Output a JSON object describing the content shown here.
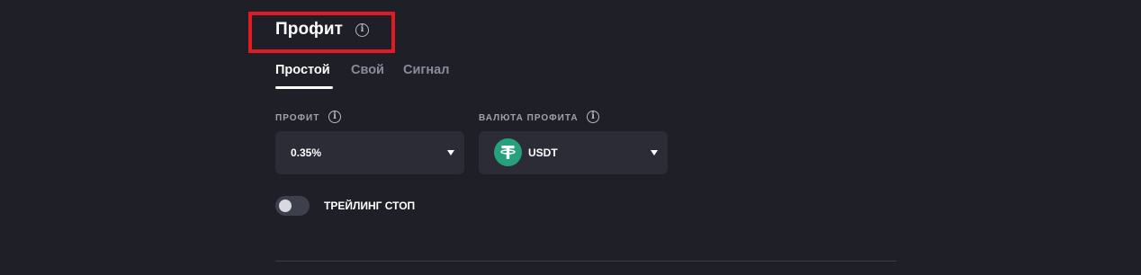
{
  "section": {
    "title": "Профит",
    "info_icon": "info-icon"
  },
  "tabs": [
    {
      "label": "Простой",
      "active": true
    },
    {
      "label": "Свой",
      "active": false
    },
    {
      "label": "Сигнал",
      "active": false
    }
  ],
  "profit_field": {
    "label": "ПРОФИТ",
    "value": "0.35%",
    "info_icon": "info-icon",
    "caret_icon": "caret-down-icon"
  },
  "currency_field": {
    "label": "ВАЛЮТА ПРОФИТА",
    "value": "USDT",
    "coin_icon": "tether-icon",
    "info_icon": "info-icon",
    "caret_icon": "caret-down-icon"
  },
  "trailing_stop": {
    "label": "ТРЕЙЛИНГ СТОП",
    "enabled": false
  },
  "colors": {
    "background": "#1e1f27",
    "field_background": "#2b2c36",
    "highlight": "#e01b24",
    "tether_green": "#26a17b",
    "inactive_tab": "#8a8c9a"
  }
}
